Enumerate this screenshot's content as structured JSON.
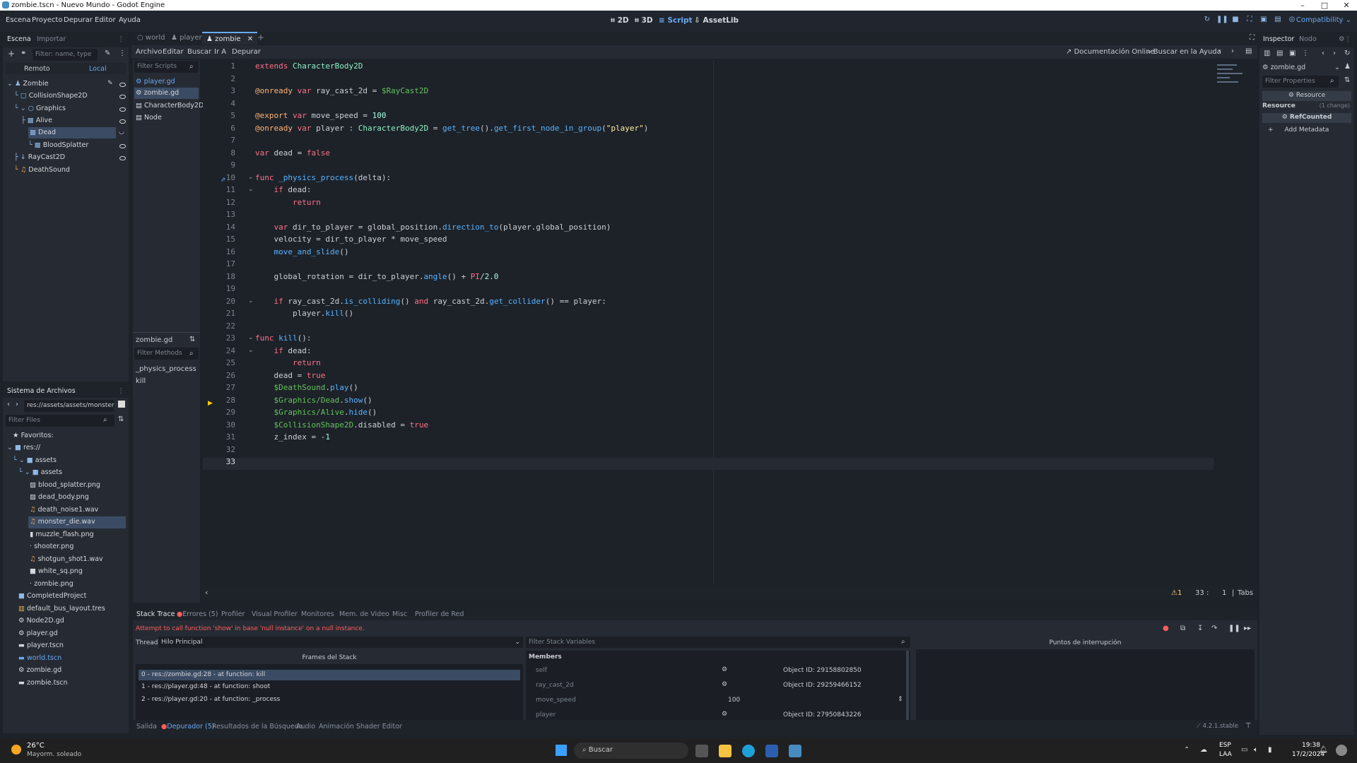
{
  "window": {
    "title": "zombie.tscn - Nuevo Mundo - Godot Engine",
    "minimize": "–",
    "maximize": "□",
    "close": "✕"
  },
  "menu": [
    "Escena",
    "Proyecto",
    "Depurar",
    "Editor",
    "Ayuda"
  ],
  "workspaces": [
    {
      "label": "2D",
      "icon": "2d-icon"
    },
    {
      "label": "3D",
      "icon": "3d-icon"
    },
    {
      "label": "Script",
      "icon": "script-icon"
    },
    {
      "label": "AssetLib",
      "icon": "assetlib-icon"
    }
  ],
  "renderer": "Compatibility",
  "scene_dock": {
    "tabs": [
      "Escena",
      "Importar"
    ],
    "filter_placeholder": "Filter: name, type",
    "remote": "Remoto",
    "local": "Local",
    "nodes": [
      "Zombie",
      "CollisionShape2D",
      "Graphics",
      "Alive",
      "Dead",
      "BloodSplatter",
      "RayCast2D",
      "DeathSound"
    ]
  },
  "filesystem": {
    "title": "Sistema de Archivos",
    "path": "res://assets/assets/monster_di",
    "filter_placeholder": "Filter Files",
    "favorites": "Favoritos:",
    "items": [
      "res://",
      "assets",
      "assets",
      "blood_splatter.png",
      "dead_body.png",
      "death_noise1.wav",
      "monster_die.wav",
      "muzzle_flash.png",
      "shooter.png",
      "shotgun_shot1.wav",
      "white_sq.png",
      "zombie.png",
      "CompletedProject",
      "default_bus_layout.tres",
      "Node2D.gd",
      "player.gd",
      "player.tscn",
      "world.tscn",
      "zombie.gd",
      "zombie.tscn"
    ]
  },
  "scene_tabs": [
    "world",
    "player",
    "zombie"
  ],
  "script_menu": [
    "Archivo",
    "Editar",
    "Buscar",
    "Ir A",
    "Depurar"
  ],
  "script_links": [
    "Documentación Online",
    "Buscar en la Ayuda"
  ],
  "script_list": {
    "filter_placeholder": "Filter Scripts",
    "items": [
      "player.gd",
      "zombie.gd",
      "CharacterBody2D",
      "Node"
    ],
    "current": "zombie.gd",
    "methods_placeholder": "Filter Methods",
    "methods": [
      "_physics_process",
      "kill"
    ]
  },
  "code_lines": [
    "extends CharacterBody2D",
    "",
    "@onready var ray_cast_2d = $RayCast2D",
    "",
    "@export var move_speed = 100",
    "@onready var player : CharacterBody2D = get_tree().get_first_node_in_group(\"player\")",
    "",
    "var dead = false",
    "",
    "func _physics_process(delta):",
    "    if dead:",
    "        return",
    "",
    "    var dir_to_player = global_position.direction_to(player.global_position)",
    "    velocity = dir_to_player * move_speed",
    "    move_and_slide()",
    "",
    "    global_rotation = dir_to_player.angle() + PI/2.0",
    "",
    "    if ray_cast_2d.is_colliding() and ray_cast_2d.get_collider() == player:",
    "        player.kill()",
    "",
    "func kill():",
    "    if dead:",
    "        return",
    "    dead = true",
    "    $DeathSound.play()",
    "    $Graphics/Dead.show()",
    "    $Graphics/Alive.hide()",
    "    $CollisionShape2D.disabled = true",
    "    z_index = -1",
    "",
    ""
  ],
  "status": {
    "warnings": "1",
    "line": "33",
    "col": "1",
    "indent": "Tabs"
  },
  "inspector": {
    "tabs": [
      "Inspector",
      "Nodo"
    ],
    "file": "zombie.gd",
    "filter_placeholder": "Filter Properties",
    "resource_header": "Resource",
    "resource": "Resource",
    "change": "(1 change)",
    "refcounted": "RefCounted",
    "add_metadata": "Add Metadata"
  },
  "debugger": {
    "tabs": [
      "Stack Trace",
      "Errores (5)",
      "Profiler",
      "Visual Profiler",
      "Monitores",
      "Mem. de Video",
      "Misc",
      "Profiler de Red"
    ],
    "error": "Attempt to call function 'show' in base 'null instance' on a null instance.",
    "thread_label": "Thread:",
    "thread": "Hilo Principal",
    "frames_title": "Frames del Stack",
    "frames": [
      "0 - res://zombie.gd:28 - at function: kill",
      "1 - res://player.gd:48 - at function: shoot",
      "2 - res://player.gd:20 - at function: _process"
    ],
    "filter_vars": "Filter Stack Variables",
    "members": "Members",
    "vars": [
      {
        "name": "self",
        "value": "Object ID: 29158802850"
      },
      {
        "name": "ray_cast_2d",
        "value": "Object ID: 29259466152"
      },
      {
        "name": "move_speed",
        "value": "100"
      },
      {
        "name": "player",
        "value": "Object ID: 27950843226"
      }
    ],
    "breakpoints": "Puntos de interrupción"
  },
  "bottom_tabs": [
    "Salida",
    "Depurador (5)",
    "Resultados de la Búsqueda",
    "Audio",
    "Animación",
    "Shader Editor"
  ],
  "version": "4.2.1.stable",
  "taskbar": {
    "temp": "26°C",
    "weather": "Mayorm. soleado",
    "search": "Buscar",
    "lang": "ESP",
    "lang2": "LAA",
    "time": "19:38",
    "date": "17/2/2024"
  },
  "colors": {
    "accent": "#478cbf",
    "bg": "#1d2229",
    "panel": "#262b33",
    "selected": "#3b4b63",
    "error_text": "#ff5d5d"
  }
}
